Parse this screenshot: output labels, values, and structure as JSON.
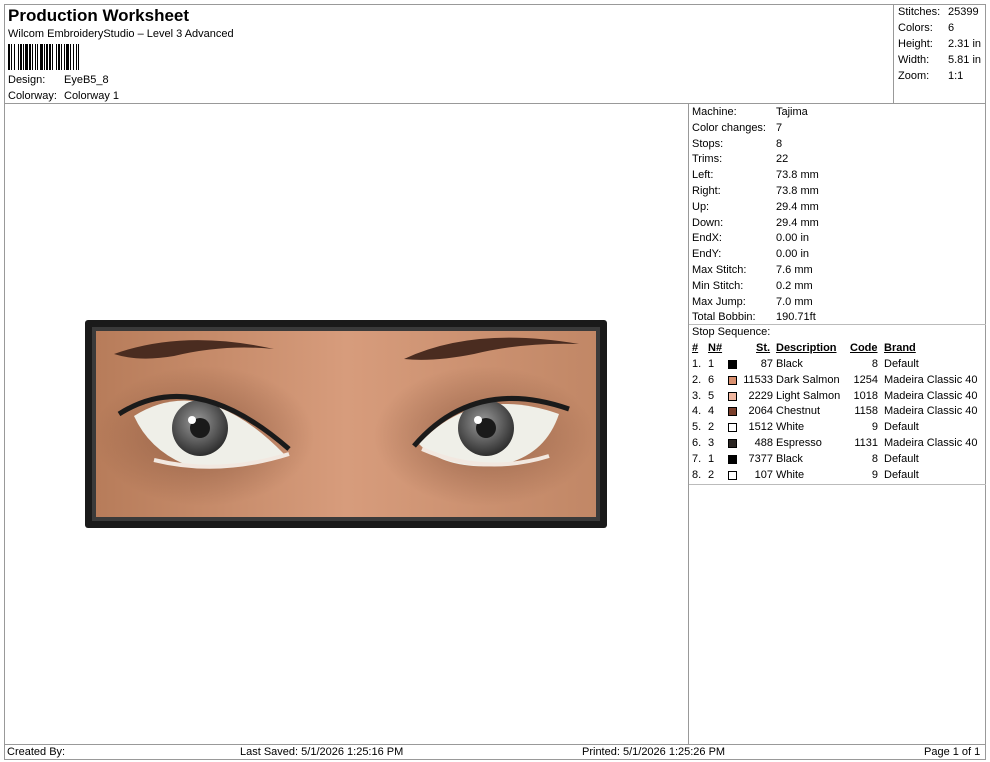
{
  "header": {
    "title": "Production Worksheet",
    "subtitle": "Wilcom EmbroideryStudio – Level 3 Advanced",
    "design_label": "Design:",
    "design_value": "EyeB5_8",
    "colorway_label": "Colorway:",
    "colorway_value": "Colorway 1"
  },
  "stats": [
    {
      "label": "Stitches:",
      "value": "25399"
    },
    {
      "label": "Colors:",
      "value": "6"
    },
    {
      "label": "Height:",
      "value": "2.31 in"
    },
    {
      "label": "Width:",
      "value": "5.81 in"
    },
    {
      "label": "Zoom:",
      "value": "1:1"
    }
  ],
  "machine_info": [
    {
      "label": "Machine:",
      "value": "Tajima"
    },
    {
      "label": "Color changes:",
      "value": "7"
    },
    {
      "label": "Stops:",
      "value": "8"
    },
    {
      "label": "Trims:",
      "value": "22"
    },
    {
      "label": "Left:",
      "value": "73.8 mm"
    },
    {
      "label": "Right:",
      "value": "73.8 mm"
    },
    {
      "label": "Up:",
      "value": "29.4 mm"
    },
    {
      "label": "Down:",
      "value": "29.4 mm"
    },
    {
      "label": "EndX:",
      "value": "0.00 in"
    },
    {
      "label": "EndY:",
      "value": "0.00 in"
    },
    {
      "label": "Max Stitch:",
      "value": "7.6 mm"
    },
    {
      "label": "Min Stitch:",
      "value": "0.2 mm"
    },
    {
      "label": "Max Jump:",
      "value": "7.0 mm"
    },
    {
      "label": "Total Bobbin:",
      "value": "190.71ft"
    }
  ],
  "stop_sequence": {
    "title": "Stop Sequence:",
    "headers": {
      "num": "#",
      "nnum": "N#",
      "st": "St.",
      "desc": "Description",
      "code": "Code",
      "brand": "Brand"
    },
    "rows": [
      {
        "num": "1.",
        "n": "1",
        "st": "87",
        "desc": "Black",
        "code": "8",
        "brand": "Default",
        "color": "#000000"
      },
      {
        "num": "2.",
        "n": "6",
        "st": "11533",
        "desc": "Dark Salmon",
        "code": "1254",
        "brand": "Madeira Classic 40",
        "color": "#d9906f"
      },
      {
        "num": "3.",
        "n": "5",
        "st": "2229",
        "desc": "Light Salmon",
        "code": "1018",
        "brand": "Madeira Classic 40",
        "color": "#f0b7a0"
      },
      {
        "num": "4.",
        "n": "4",
        "st": "2064",
        "desc": "Chestnut",
        "code": "1158",
        "brand": "Madeira Classic 40",
        "color": "#7a3e2a"
      },
      {
        "num": "5.",
        "n": "2",
        "st": "1512",
        "desc": "White",
        "code": "9",
        "brand": "Default",
        "color": "#ffffff"
      },
      {
        "num": "6.",
        "n": "3",
        "st": "488",
        "desc": "Espresso",
        "code": "1131",
        "brand": "Madeira Classic 40",
        "color": "#2a2421"
      },
      {
        "num": "7.",
        "n": "1",
        "st": "7377",
        "desc": "Black",
        "code": "8",
        "brand": "Default",
        "color": "#000000"
      },
      {
        "num": "8.",
        "n": "2",
        "st": "107",
        "desc": "White",
        "code": "9",
        "brand": "Default",
        "color": "#ffffff"
      }
    ]
  },
  "footer": {
    "created_by": "Created By:",
    "last_saved": "Last Saved: 5/1/2026 1:25:16 PM",
    "printed": "Printed: 5/1/2026 1:25:26 PM",
    "page": "Page 1 of 1"
  },
  "design_image": {
    "border_color": "#1a1a1a",
    "skin_color": "#c8906e",
    "iris_color": "#555555"
  }
}
